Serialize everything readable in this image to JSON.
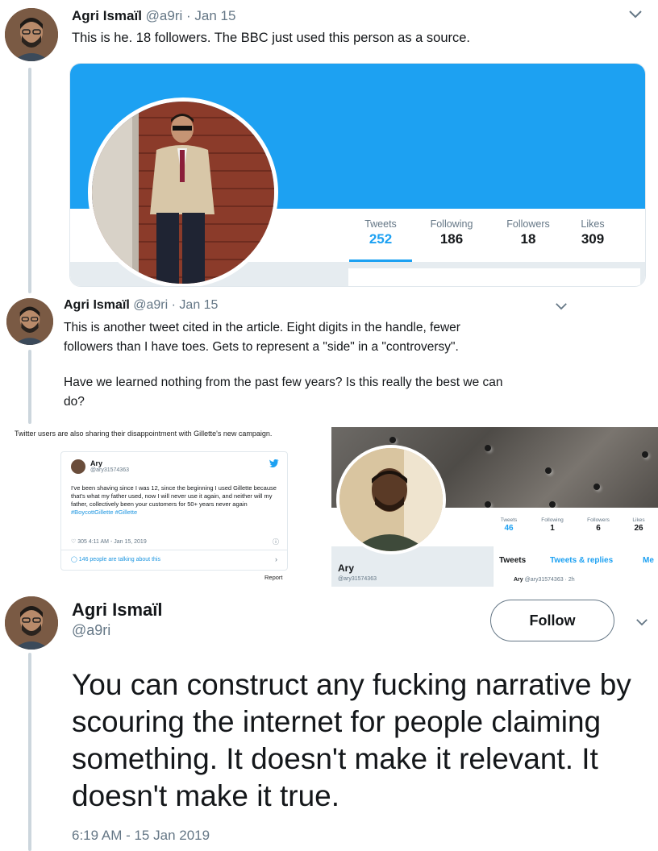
{
  "tweet1": {
    "name": "Agri Ismaïl",
    "handle": "@a9ri",
    "date": "· Jan 15",
    "text": "This is he. 18 followers. The BBC just used this person as a source.",
    "menu_icon": "chevron-down-icon"
  },
  "profile_card": {
    "banner_color": "#1da1f2",
    "stats": [
      {
        "label": "Tweets",
        "value": "252"
      },
      {
        "label": "Following",
        "value": "186"
      },
      {
        "label": "Followers",
        "value": "18"
      },
      {
        "label": "Likes",
        "value": "309"
      }
    ]
  },
  "tweet2": {
    "name": "Agri Ismaïl",
    "handle": "@a9ri",
    "date": "· Jan 15",
    "text_line1": "This is another tweet cited in the article. Eight digits in the handle, fewer",
    "text_line2": "followers than I have toes. Gets to represent a \"side\" in a \"controversy\".",
    "text_line3": "Have we learned nothing from the past few years? Is this really the best we can",
    "text_line4": "do?"
  },
  "article": {
    "caption": "Twitter users are also sharing their disappointment with Gillette's new campaign.",
    "embedded_tweet": {
      "name": "Ary",
      "handle": "@ary31574363",
      "text": "I've been shaving since I was 12, since the beginning I used Gillette because that's what my father used, now I will never use it again, and neither will my father, collectively been your customers for 50+ years never again",
      "hashtags": "#BoycottGillette #Gillette",
      "likes_time": "♡ 305   4:11 AM - Jan 15, 2019",
      "talking": "◯ 146 people are talking about this"
    },
    "report": "Report"
  },
  "ary_profile": {
    "name": "Ary",
    "handle": "@ary31574363",
    "stats": [
      {
        "label": "Tweets",
        "value": "46"
      },
      {
        "label": "Following",
        "value": "1"
      },
      {
        "label": "Followers",
        "value": "6"
      },
      {
        "label": "Likes",
        "value": "26"
      }
    ],
    "tabs": [
      "Tweets",
      "Tweets & replies",
      "Me"
    ],
    "item_name": "Ary",
    "item_meta": "@ary31574363 · 2h"
  },
  "tweet3": {
    "name": "Agri Ismaïl",
    "handle": "@a9ri",
    "follow_label": "Follow",
    "text": "You can construct any fucking narrative by scouring the internet for people claiming something. It doesn't make it relevant. It doesn't make it true.",
    "timestamp": "6:19 AM - 15 Jan 2019"
  }
}
